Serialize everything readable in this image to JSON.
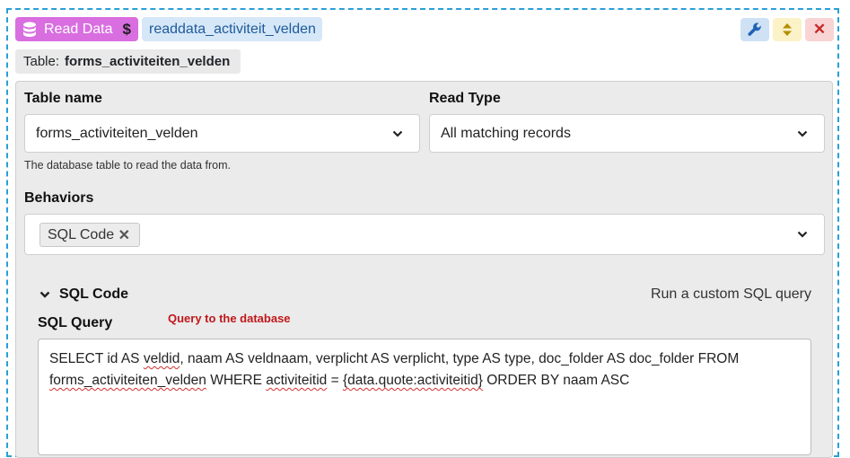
{
  "header": {
    "type_label": "Read Data",
    "dollar": "$",
    "instance_name": "readdata_activiteit_velden",
    "close_glyph": "✕",
    "colors": {
      "type_badge": "#d96ee0",
      "name_badge": "#d6e7f7",
      "border": "#2a9fd6"
    }
  },
  "table_tag": {
    "key": "Table:",
    "value": "forms_activiteiten_velden"
  },
  "form": {
    "table_name": {
      "label": "Table name",
      "value": "forms_activiteiten_velden",
      "help": "The database table to read the data from."
    },
    "read_type": {
      "label": "Read Type",
      "value": "All matching records"
    },
    "behaviors": {
      "label": "Behaviors",
      "chips": [
        {
          "label": "SQL Code",
          "remove_glyph": "✕"
        }
      ]
    }
  },
  "sql_section": {
    "title": "SQL Code",
    "description": "Run a custom SQL query",
    "query_label": "SQL Query",
    "note": "Query to the database",
    "query_segments": [
      {
        "text": "SELECT id AS ",
        "spell": false
      },
      {
        "text": "veldid",
        "spell": true
      },
      {
        "text": ", naam AS veldnaam, verplicht AS verplicht, type AS type, doc_folder AS doc_folder FROM ",
        "spell": false
      },
      {
        "text": "forms_activiteiten_velden",
        "spell": true
      },
      {
        "text": " WHERE ",
        "spell": false
      },
      {
        "text": "activiteitid",
        "spell": true
      },
      {
        "text": " = ",
        "spell": false
      },
      {
        "text": "{data.quote:activiteitid}",
        "spell": true
      },
      {
        "text": " ORDER BY naam ASC",
        "spell": false
      }
    ]
  },
  "icons": [
    "database-icon",
    "dollar-icon",
    "wrench-icon",
    "sort-icon",
    "close-icon",
    "chevron-down-icon"
  ]
}
